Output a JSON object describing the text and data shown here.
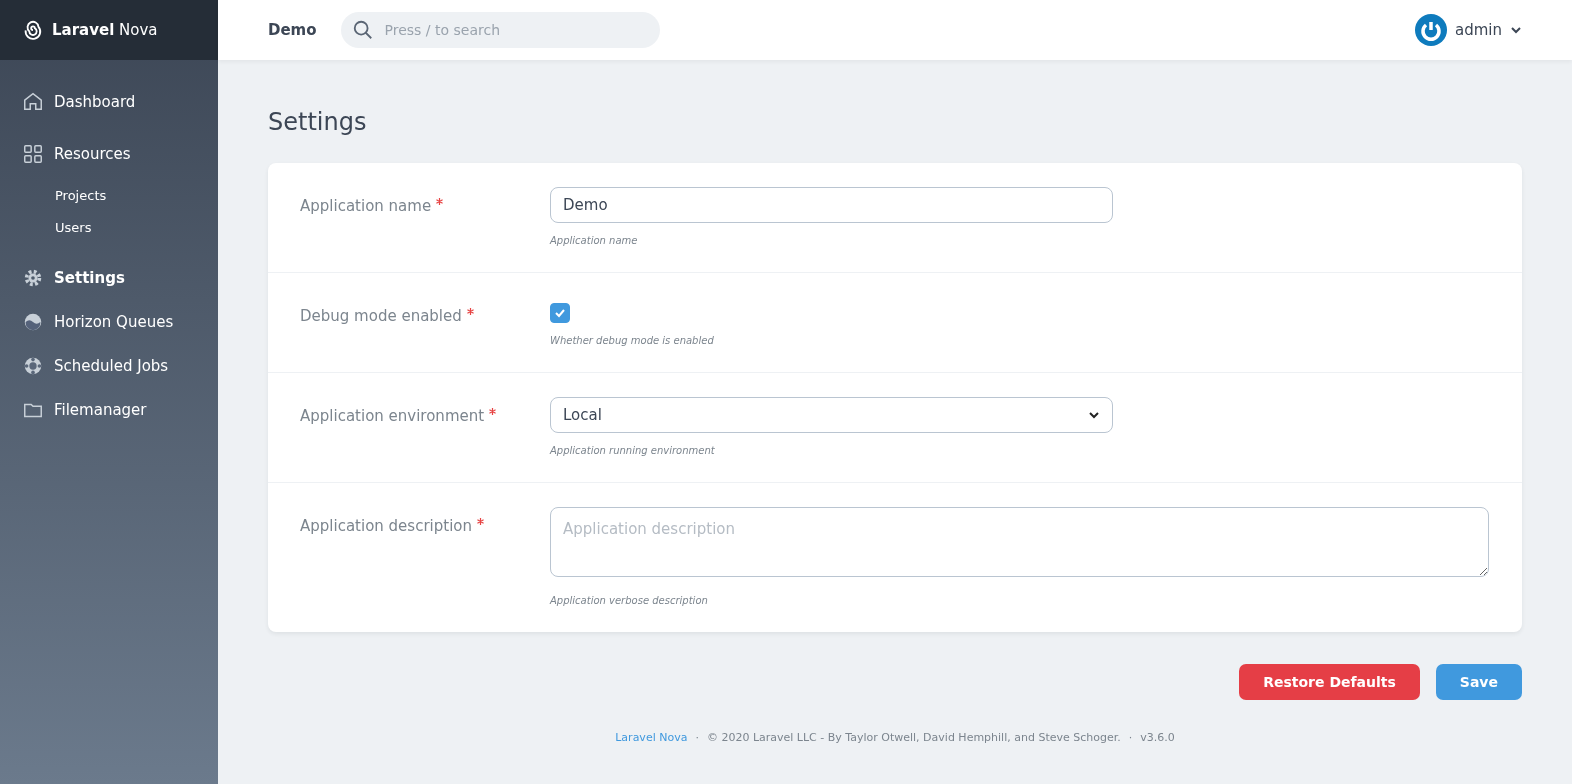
{
  "brand": "**Laravel** Nova",
  "sidebar": {
    "items": [
      {
        "label": "Dashboard",
        "kind": "main",
        "selected": false
      },
      {
        "label": "Resources",
        "kind": "main",
        "selected": false
      },
      {
        "label": "Projects",
        "kind": "sub",
        "selected": false
      },
      {
        "label": "Users",
        "kind": "sub",
        "selected": false
      },
      {
        "label": "Settings",
        "kind": "main",
        "selected": true
      },
      {
        "label": "Horizon Queues",
        "kind": "main",
        "selected": false
      },
      {
        "label": "Scheduled Jobs",
        "kind": "main",
        "selected": false
      },
      {
        "label": "Filemanager",
        "kind": "main",
        "selected": false
      }
    ]
  },
  "topbar": {
    "app_name": "Demo",
    "search": {
      "placeholder": "Press / to search"
    },
    "user": "admin"
  },
  "page_title": "Settings",
  "fields": [
    {
      "label": "Application name",
      "required": true,
      "kind": "text",
      "value": "Demo",
      "help": "Application name"
    },
    {
      "label": "Debug mode enabled",
      "required": true,
      "kind": "checkbox",
      "checked": true,
      "help": "Whether debug mode is enabled"
    },
    {
      "label": "Application environment",
      "required": true,
      "kind": "select",
      "value": "Local",
      "help": "Application running environment"
    },
    {
      "label": "Application description",
      "required": true,
      "kind": "textarea",
      "placeholder": "Application description",
      "help": "Application verbose description"
    }
  ],
  "buttons": [
    {
      "label": "Restore Defaults",
      "kind": "danger"
    },
    {
      "label": "Save",
      "kind": "primary"
    }
  ],
  "footer": [
    {
      "text": "Laravel Nova",
      "kind": "link"
    },
    {
      "text": "·",
      "kind": "sep"
    },
    {
      "text": "© 2020 Laravel LLC - By Taylor Otwell, David Hemphill, and Steve Schoger.",
      "kind": "text"
    },
    {
      "text": "·",
      "kind": "sep"
    },
    {
      "text": "v3.6.0",
      "kind": "text"
    }
  ]
}
